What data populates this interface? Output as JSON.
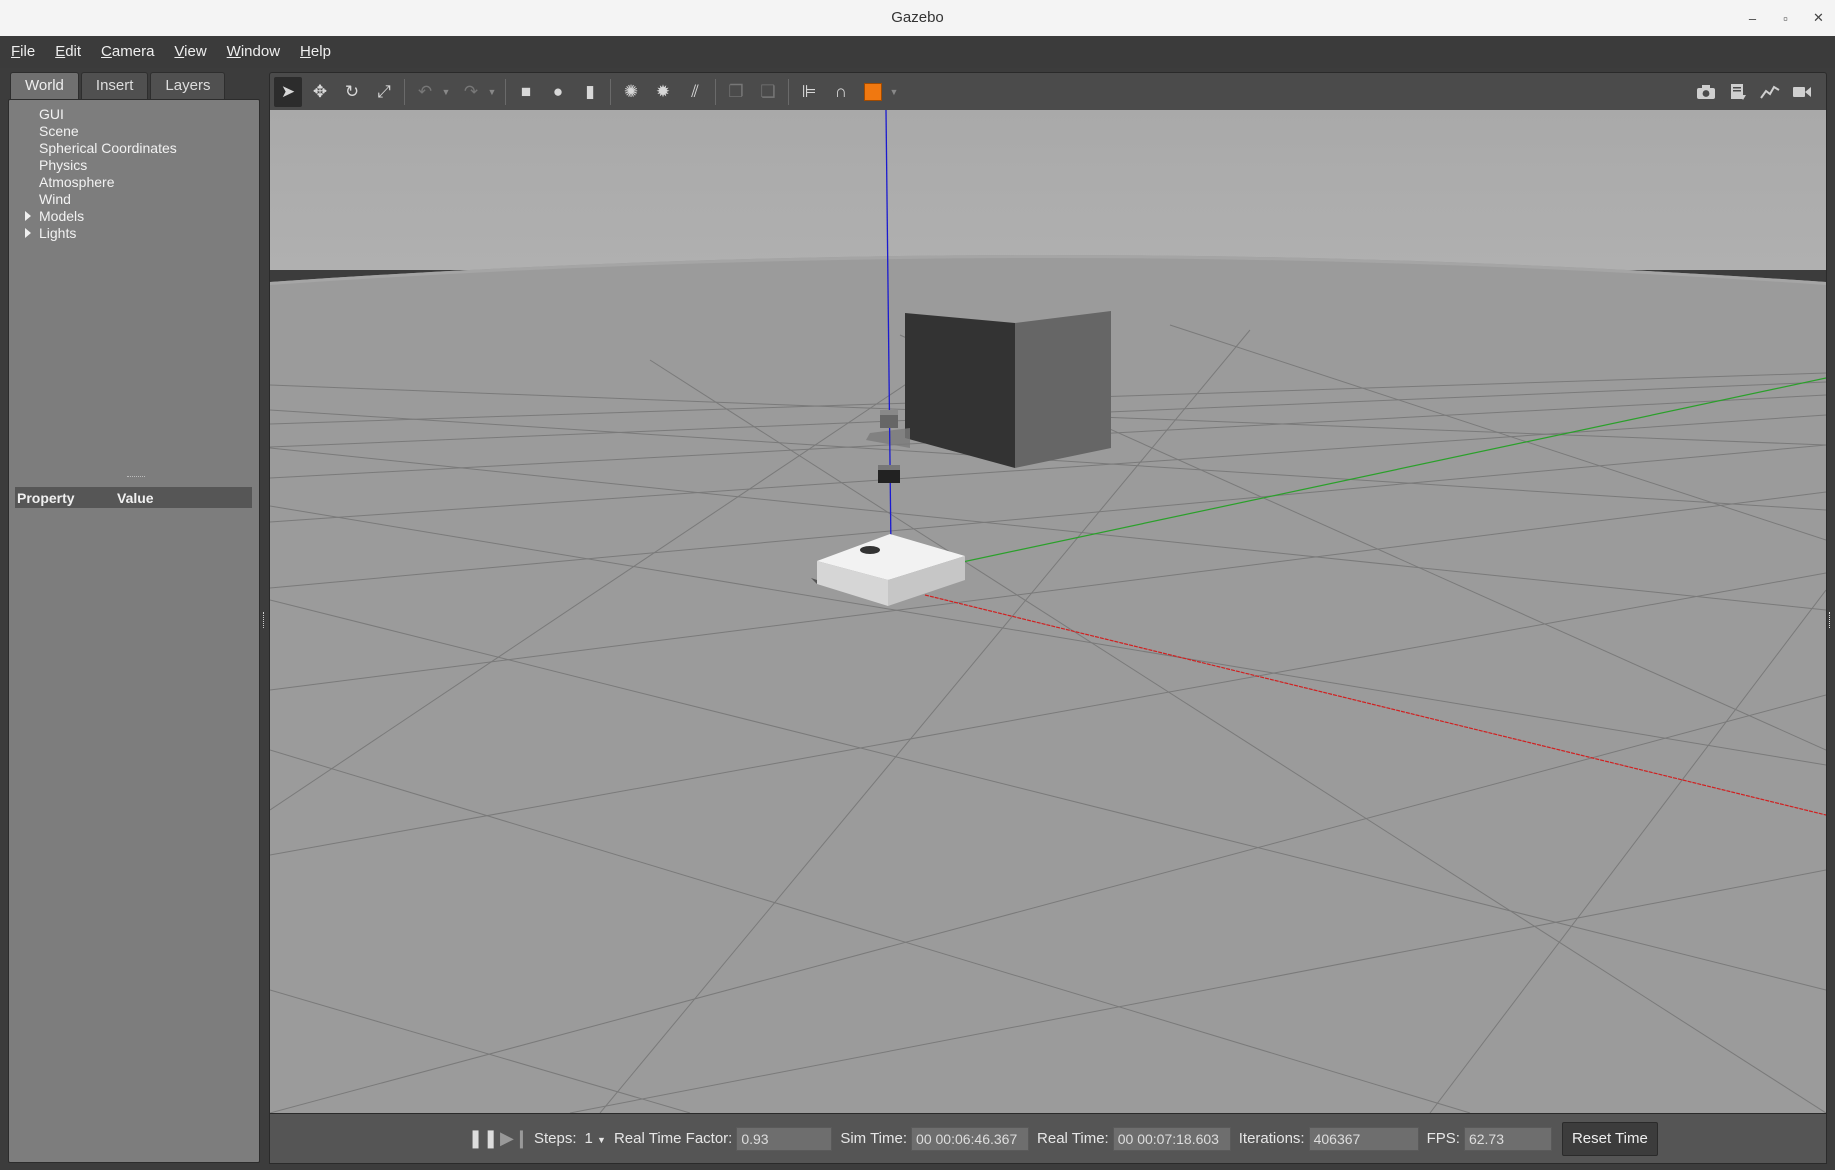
{
  "window": {
    "title": "Gazebo",
    "controls": [
      "–",
      "▫",
      "✕"
    ]
  },
  "menu": [
    {
      "label": "File",
      "mnemonic": "F",
      "rest": "ile"
    },
    {
      "label": "Edit",
      "mnemonic": "E",
      "rest": "dit"
    },
    {
      "label": "Camera",
      "mnemonic": "C",
      "rest": "amera"
    },
    {
      "label": "View",
      "mnemonic": "V",
      "rest": "iew"
    },
    {
      "label": "Window",
      "mnemonic": "W",
      "rest": "indow"
    },
    {
      "label": "Help",
      "mnemonic": "H",
      "rest": "elp"
    }
  ],
  "left_panel": {
    "tabs": [
      "World",
      "Insert",
      "Layers"
    ],
    "active_tab": "World",
    "tree": [
      {
        "label": "GUI",
        "expandable": false
      },
      {
        "label": "Scene",
        "expandable": false
      },
      {
        "label": "Spherical Coordinates",
        "expandable": false
      },
      {
        "label": "Physics",
        "expandable": false
      },
      {
        "label": "Atmosphere",
        "expandable": false
      },
      {
        "label": "Wind",
        "expandable": false
      },
      {
        "label": "Models",
        "expandable": true
      },
      {
        "label": "Lights",
        "expandable": true
      }
    ],
    "property_header": {
      "property": "Property",
      "value": "Value"
    }
  },
  "toolbar": {
    "tools": [
      {
        "name": "select-mode-icon",
        "glyph": "➤",
        "selected": true
      },
      {
        "name": "translate-mode-icon",
        "glyph": "✥"
      },
      {
        "name": "rotate-mode-icon",
        "glyph": "↻"
      },
      {
        "name": "scale-mode-icon",
        "glyph": "⤢"
      }
    ],
    "history": [
      {
        "name": "undo-icon",
        "glyph": "↶"
      },
      {
        "name": "redo-icon",
        "glyph": "↷"
      }
    ],
    "shapes": [
      {
        "name": "box-shape-icon",
        "glyph": "■"
      },
      {
        "name": "sphere-shape-icon",
        "glyph": "●"
      },
      {
        "name": "cylinder-shape-icon",
        "glyph": "▮"
      }
    ],
    "lights": [
      {
        "name": "point-light-icon",
        "glyph": "✺"
      },
      {
        "name": "spot-light-icon",
        "glyph": "✹"
      },
      {
        "name": "directional-light-icon",
        "glyph": "⫽"
      }
    ],
    "clipboard": [
      {
        "name": "copy-icon",
        "glyph": "❐"
      },
      {
        "name": "paste-icon",
        "glyph": "❏"
      }
    ],
    "align": [
      {
        "name": "align-icon",
        "glyph": "⊫"
      },
      {
        "name": "snap-icon",
        "glyph": "∩"
      },
      {
        "name": "view-angle-icon",
        "glyph": "◧"
      }
    ],
    "right": [
      {
        "name": "screenshot-icon",
        "glyph": "📷"
      },
      {
        "name": "log-icon",
        "glyph": "▤"
      },
      {
        "name": "plot-icon",
        "glyph": "〰"
      },
      {
        "name": "video-record-icon",
        "glyph": "▶"
      }
    ]
  },
  "status": {
    "steps_label": "Steps:",
    "steps_value": "1",
    "rtf_label": "Real Time Factor:",
    "rtf_value": "0.93",
    "sim_time_label": "Sim Time:",
    "sim_time_value": "00 00:06:46.367",
    "real_time_label": "Real Time:",
    "real_time_value": "00 00:07:18.603",
    "iterations_label": "Iterations:",
    "iterations_value": "406367",
    "fps_label": "FPS:",
    "fps_value": "62.73",
    "reset_label": "Reset Time"
  },
  "colors": {
    "sky": "#aaaaaa",
    "ground": "#9a9a9a",
    "grid": "#7f7f7f",
    "x_axis": "#d02020",
    "y_axis": "#20a020",
    "z_axis": "#1a1ad0",
    "accent_orange": "#f07810"
  }
}
